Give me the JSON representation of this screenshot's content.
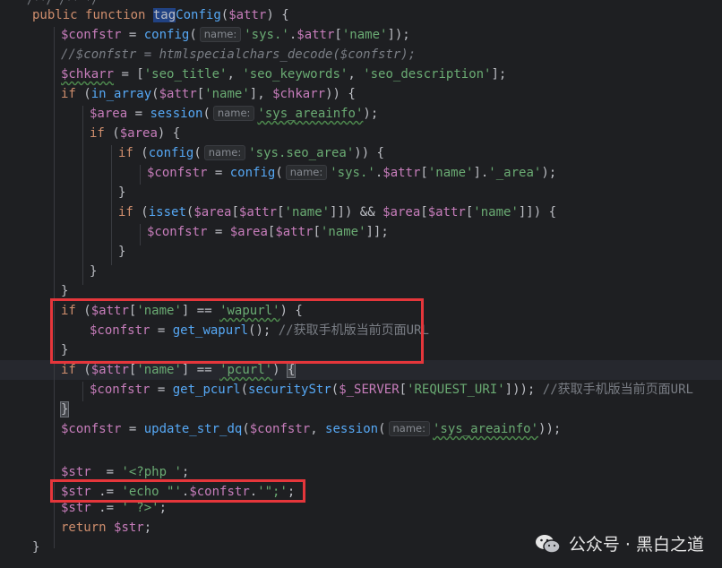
{
  "editor": {
    "top_fragment": "/**/ /** */",
    "lines": [
      {
        "parts": [
          [
            "kw",
            "public "
          ],
          [
            "kw",
            "function "
          ],
          [
            "sel",
            "tag"
          ],
          [
            "fn",
            "Config"
          ],
          [
            "plain",
            "("
          ],
          [
            "var",
            "$attr"
          ],
          [
            "plain",
            ") {"
          ]
        ]
      },
      {
        "parts": [
          [
            "var",
            "$confstr"
          ],
          [
            "plain",
            " = "
          ],
          [
            "fn",
            "config"
          ],
          [
            "plain",
            "("
          ],
          [
            "hint",
            "name:"
          ],
          [
            "str",
            "'sys.'"
          ],
          [
            "plain",
            "."
          ],
          [
            "var",
            "$attr"
          ],
          [
            "plain",
            "["
          ],
          [
            "str",
            "'name'"
          ],
          [
            "plain",
            "]);"
          ]
        ]
      },
      {
        "parts": [
          [
            "cmt",
            "//$confstr = htmlspecialchars_decode($confstr);"
          ]
        ]
      },
      {
        "parts": [
          [
            "var",
            "$chkarr"
          ],
          [
            "plain",
            " = ["
          ],
          [
            "str",
            "'seo_title'"
          ],
          [
            "plain",
            ", "
          ],
          [
            "str",
            "'seo_keywords'"
          ],
          [
            "plain",
            ", "
          ],
          [
            "str",
            "'seo_description'"
          ],
          [
            "plain",
            "];"
          ]
        ]
      },
      {
        "parts": [
          [
            "kw",
            "if "
          ],
          [
            "plain",
            "("
          ],
          [
            "fn",
            "in_array"
          ],
          [
            "plain",
            "("
          ],
          [
            "var",
            "$attr"
          ],
          [
            "plain",
            "["
          ],
          [
            "str",
            "'name'"
          ],
          [
            "plain",
            "], "
          ],
          [
            "var",
            "$chkarr"
          ],
          [
            "plain",
            ")) {"
          ]
        ]
      },
      {
        "parts": [
          [
            "var",
            "$area"
          ],
          [
            "plain",
            " = "
          ],
          [
            "fn",
            "session"
          ],
          [
            "plain",
            "("
          ],
          [
            "hint",
            "name:"
          ],
          [
            "str",
            "'sys_areainfo'"
          ],
          [
            "plain",
            ");"
          ]
        ]
      },
      {
        "parts": [
          [
            "kw",
            "if "
          ],
          [
            "plain",
            "("
          ],
          [
            "var",
            "$area"
          ],
          [
            "plain",
            ") {"
          ]
        ]
      },
      {
        "parts": [
          [
            "kw",
            "if "
          ],
          [
            "plain",
            "("
          ],
          [
            "fn",
            "config"
          ],
          [
            "plain",
            "("
          ],
          [
            "hint",
            "name:"
          ],
          [
            "str",
            "'sys.seo_area'"
          ],
          [
            "plain",
            ")) {"
          ]
        ]
      },
      {
        "parts": [
          [
            "var",
            "$confstr"
          ],
          [
            "plain",
            " = "
          ],
          [
            "fn",
            "config"
          ],
          [
            "plain",
            "("
          ],
          [
            "hint",
            "name:"
          ],
          [
            "str",
            "'sys.'"
          ],
          [
            "plain",
            "."
          ],
          [
            "var",
            "$attr"
          ],
          [
            "plain",
            "["
          ],
          [
            "str",
            "'name'"
          ],
          [
            "plain",
            "]."
          ],
          [
            "str",
            "'_area'"
          ],
          [
            "plain",
            ");"
          ]
        ]
      },
      {
        "parts": [
          [
            "plain",
            "}"
          ]
        ]
      },
      {
        "parts": [
          [
            "kw",
            "if "
          ],
          [
            "plain",
            "("
          ],
          [
            "fn",
            "isset"
          ],
          [
            "plain",
            "("
          ],
          [
            "var",
            "$area"
          ],
          [
            "plain",
            "["
          ],
          [
            "var",
            "$attr"
          ],
          [
            "plain",
            "["
          ],
          [
            "str",
            "'name'"
          ],
          [
            "plain",
            "]]) && "
          ],
          [
            "var",
            "$area"
          ],
          [
            "plain",
            "["
          ],
          [
            "var",
            "$attr"
          ],
          [
            "plain",
            "["
          ],
          [
            "str",
            "'name'"
          ],
          [
            "plain",
            "]]) {"
          ]
        ]
      },
      {
        "parts": [
          [
            "var",
            "$confstr"
          ],
          [
            "plain",
            " = "
          ],
          [
            "var",
            "$area"
          ],
          [
            "plain",
            "["
          ],
          [
            "var",
            "$attr"
          ],
          [
            "plain",
            "["
          ],
          [
            "str",
            "'name'"
          ],
          [
            "plain",
            "]];"
          ]
        ]
      },
      {
        "parts": [
          [
            "plain",
            "}"
          ]
        ]
      },
      {
        "parts": [
          [
            "plain",
            "}"
          ]
        ]
      },
      {
        "parts": [
          [
            "plain",
            "}"
          ]
        ]
      },
      {
        "parts": [
          [
            "kw",
            "if "
          ],
          [
            "plain",
            "("
          ],
          [
            "var",
            "$attr"
          ],
          [
            "plain",
            "["
          ],
          [
            "str",
            "'name'"
          ],
          [
            "plain",
            "] == "
          ],
          [
            "str",
            "'wapurl'"
          ],
          [
            "plain",
            ") {"
          ]
        ]
      },
      {
        "parts": [
          [
            "var",
            "$confstr"
          ],
          [
            "plain",
            " = "
          ],
          [
            "fn",
            "get_wapurl"
          ],
          [
            "plain",
            "(); "
          ],
          [
            "cmt-cn",
            "//获取手机版当前页面URL"
          ]
        ]
      },
      {
        "parts": [
          [
            "plain",
            "}"
          ]
        ]
      },
      {
        "parts": [
          [
            "kw",
            "if "
          ],
          [
            "plain",
            "("
          ],
          [
            "var",
            "$attr"
          ],
          [
            "plain",
            "["
          ],
          [
            "str",
            "'name'"
          ],
          [
            "plain",
            "] == "
          ],
          [
            "str",
            "'pcurl'"
          ],
          [
            "plain",
            ") "
          ],
          [
            "match",
            "{"
          ]
        ]
      },
      {
        "parts": [
          [
            "var",
            "$confstr"
          ],
          [
            "plain",
            " = "
          ],
          [
            "fn",
            "get_pcurl"
          ],
          [
            "plain",
            "("
          ],
          [
            "fn",
            "securityStr"
          ],
          [
            "plain",
            "("
          ],
          [
            "var",
            "$_SERVER"
          ],
          [
            "plain",
            "["
          ],
          [
            "str",
            "'REQUEST_URI'"
          ],
          [
            "plain",
            "])); "
          ],
          [
            "cmt-cn",
            "//获取手机版当前页面URL"
          ]
        ]
      },
      {
        "parts": [
          [
            "match",
            "}"
          ]
        ]
      },
      {
        "parts": [
          [
            "var",
            "$confstr"
          ],
          [
            "plain",
            " = "
          ],
          [
            "fn",
            "update_str_dq"
          ],
          [
            "plain",
            "("
          ],
          [
            "var",
            "$confstr"
          ],
          [
            "plain",
            ", "
          ],
          [
            "fn",
            "session"
          ],
          [
            "plain",
            "("
          ],
          [
            "hint",
            "name:"
          ],
          [
            "str",
            "'sys_areainfo'"
          ],
          [
            "plain",
            "));"
          ]
        ]
      },
      {
        "parts": []
      },
      {
        "parts": [
          [
            "var",
            "$str"
          ],
          [
            "plain",
            "  = "
          ],
          [
            "str",
            "'<?php '"
          ],
          [
            "plain",
            ";"
          ]
        ]
      },
      {
        "parts": [
          [
            "var",
            "$str"
          ],
          [
            "plain",
            " .= "
          ],
          [
            "str",
            "'echo \"'"
          ],
          [
            "plain",
            "."
          ],
          [
            "var",
            "$confstr"
          ],
          [
            "plain",
            "."
          ],
          [
            "str",
            "'\";'"
          ],
          [
            "plain",
            ";"
          ]
        ]
      },
      {
        "parts": [
          [
            "var",
            "$str"
          ],
          [
            "plain",
            " .= "
          ],
          [
            "str",
            "' ?>'"
          ],
          [
            "plain",
            ";"
          ]
        ]
      },
      {
        "parts": [
          [
            "kw",
            "return "
          ],
          [
            "var",
            "$str"
          ],
          [
            "plain",
            ";"
          ]
        ]
      },
      {
        "parts": [
          [
            "plain",
            "}"
          ]
        ]
      }
    ]
  },
  "watermark": {
    "text": "公众号 · 黑白之道",
    "icon": "wechat-icon"
  },
  "colors": {
    "background": "#1e1f22",
    "keyword": "#cf8e6d",
    "function": "#56a8f5",
    "variable": "#c77dbb",
    "string": "#6aab73",
    "comment": "#7a7e85",
    "highlight_box": "#e5363b"
  }
}
